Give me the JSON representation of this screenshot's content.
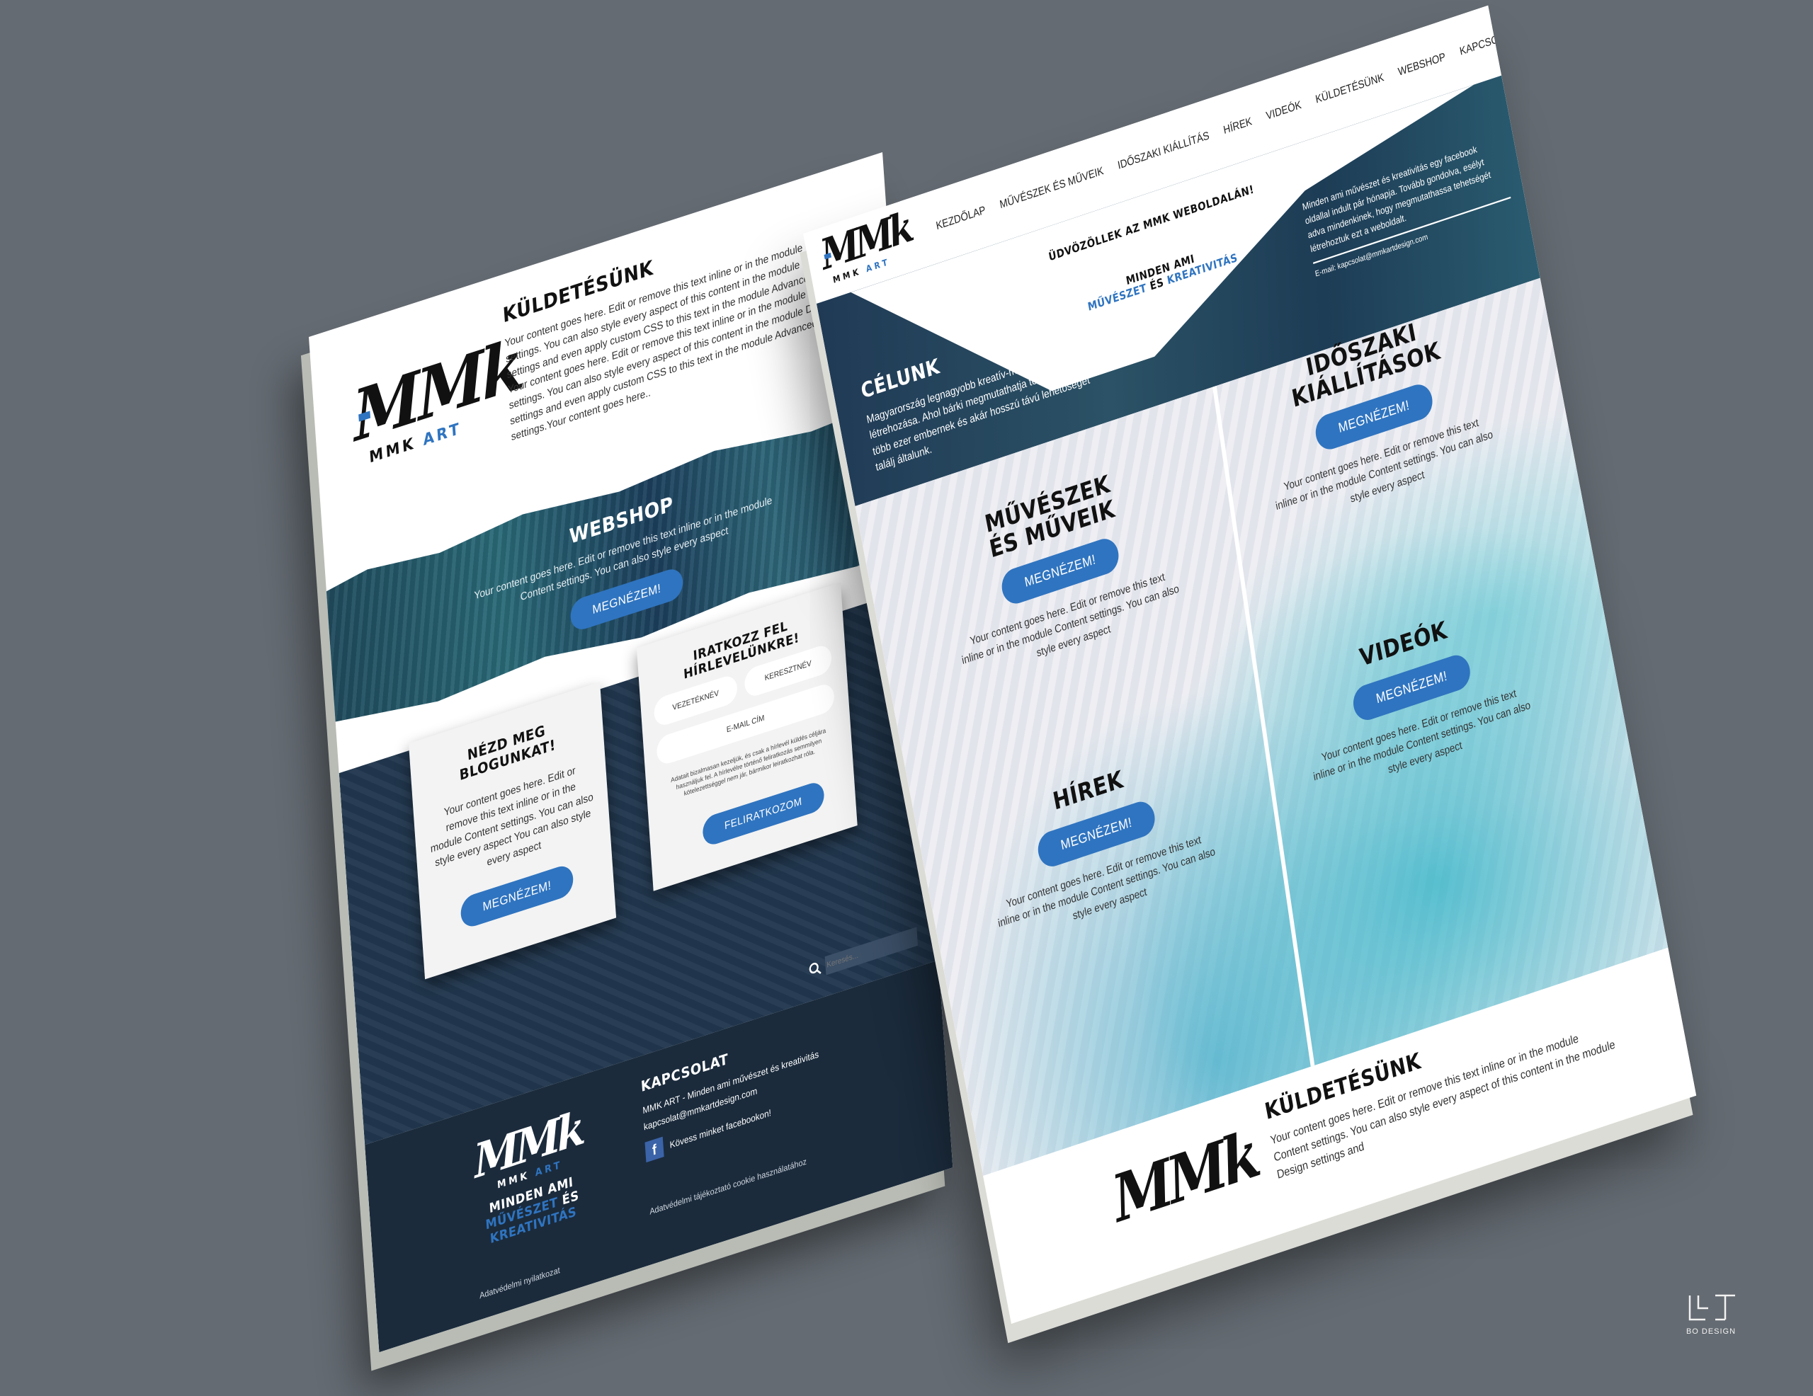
{
  "left_page": {
    "logo": {
      "monogram": "MMk",
      "name_a": "MMK",
      "name_b": "ART"
    },
    "mission": {
      "title": "KÜLDETÉSÜNK",
      "text": "Your content goes here. Edit or remove this text inline or in the module Content settings. You can also style every aspect of this content in the module Design settings and even apply custom CSS to this text in the module Advanced settings. Your content goes here. Edit or remove this text inline or in the module Content settings. You can also style every aspect of this content in the module Design settings and even apply custom CSS to this text in the module Advanced settings.Your content goes here.."
    },
    "webshop": {
      "title": "WEBSHOP",
      "text": "Your content goes here. Edit or remove this text inline or in the module Content settings. You can also style every aspect",
      "button": "MEGNÉZEM!"
    },
    "blog_card": {
      "title": "NÉZD MEG BLOGUNKAT!",
      "text": "Your content goes here. Edit or remove this text inline or in the module Content settings. You can also style every aspect You can also style every aspect",
      "button": "MEGNÉZEM!"
    },
    "newsletter_card": {
      "title": "IRATKOZZ FEL HÍRLEVELÜNKRE!",
      "field_lastname": "VEZETÉKNÉV",
      "field_firstname": "KERESZTNÉV",
      "field_email": "E-MAIL CÍM",
      "consent": "Adatait bizalmasan kezeljük, és csak a hírlevél küldés céljára használjuk fel. A hírlevélre történő feliratkozás semmilyen kötelezettséggel nem jár, bármikor leiratkozhat róla.",
      "button": "FELIRATKOZOM"
    },
    "search_placeholder": "Keresés...",
    "footer": {
      "slogan_line1": "MINDEN AMI",
      "slogan_a": "MŰVÉSZET",
      "slogan_and": "ÉS",
      "slogan_b": "KREATIVITÁS",
      "contact_title": "KAPCSOLAT",
      "contact_line": "MMK ART - Minden ami művészet és kreativitás",
      "email": "kapcsolat@mmkartdesign.com",
      "facebook": "Kövess minket facebookon!",
      "cookie_link": "Adatvédelmi tájékoztató cookie használatához",
      "privacy_link": "Adatvédelmi nyilatkozat"
    }
  },
  "right_page": {
    "nav": [
      "KEZDŐLAP",
      "MŰVÉSZEK ÉS MŰVEIK",
      "IDŐSZAKI KIÁLLÍTÁS",
      "HÍREK",
      "VIDEÓK",
      "KÜLDETÉSÜNK",
      "WEBSHOP",
      "KAPCSOLAT"
    ],
    "welcome": "ÜDVÖZÖLLEK AZ MMK WEBOLDALÁN!",
    "slogan_line1": "MINDEN AMI",
    "slogan_a": "MŰVÉSZET",
    "slogan_and": "ÉS",
    "slogan_b": "KREATIVITÁS",
    "goal": {
      "title": "CÉLUNK",
      "text": "Magyarország legnagyobb kreatív-művész közösség létrehozása. Ahol bárki megmutathatja tehetségét több ezer embernek és akár hosszú távú lehetőséget találj általunk."
    },
    "about": {
      "text": "Minden ami művészet és kreativitás egy facebook oldallal indult pár hónapja. Tovább gondolva, esélyt adva mindenkinek, hogy megmutathassa tehetségét létrehoztuk ezt a weboldalt.",
      "email": "E-mail: kapcsolat@mmkartdesign.com"
    },
    "artists": {
      "title_line1": "MŰVÉSZEK",
      "title_line2": "ÉS MŰVEIK",
      "button": "MEGNÉZEM!",
      "text": "Your content goes here. Edit or remove this text inline or in the module Content settings. You can also style every aspect"
    },
    "exhibitions": {
      "title_line1": "IDŐSZAKI",
      "title_line2": "KIÁLLÍTÁSOK",
      "button": "MEGNÉZEM!",
      "text": "Your content goes here. Edit or remove this text inline or in the module Content settings. You can also style every aspect"
    },
    "news": {
      "title": "HÍREK",
      "button": "MEGNÉZEM!",
      "text": "Your content goes here. Edit or remove this text inline or in the module Content settings. You can also style every aspect"
    },
    "videos": {
      "title": "VIDEÓK",
      "button": "MEGNÉZEM!",
      "text": "Your content goes here. Edit or remove this text inline or in the module Content settings. You can also style every aspect"
    },
    "mission": {
      "title": "KÜLDETÉSÜNK",
      "text": "Your content goes here. Edit or remove this text inline or in the module Content settings. You can also style every aspect of this content in the module Design settings and"
    }
  },
  "credit": {
    "label": "BO DESIGN"
  },
  "colors": {
    "background": "#646b72",
    "accent_blue": "#2f74c0",
    "navy": "#22384f"
  }
}
